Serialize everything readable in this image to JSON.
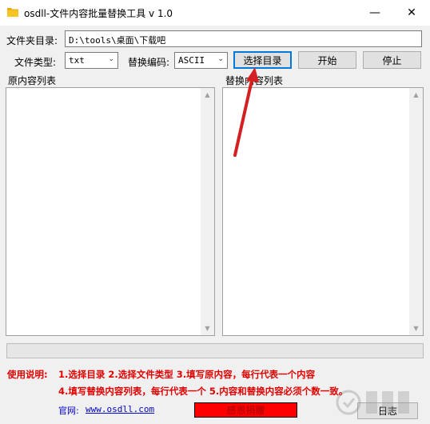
{
  "window": {
    "title": "osdll-文件内容批量替换工具 v 1.0",
    "minimize": "—",
    "close": "✕"
  },
  "folder": {
    "label": "文件夹目录:",
    "value": "D:\\tools\\桌面\\下载吧"
  },
  "file_type": {
    "label": "文件类型:",
    "value": "txt"
  },
  "encoding": {
    "label": "替换编码:",
    "value": "ASCII"
  },
  "buttons": {
    "select_dir": "选择目录",
    "start": "开始",
    "stop": "停止",
    "donate": "感恩捐赠",
    "log": "日志"
  },
  "lists": {
    "original": "原内容列表",
    "replacement": "替换内容列表"
  },
  "help": {
    "label": "使用说明:",
    "line1": "1.选择目录   2.选择文件类型   3.填写原内容，每行代表一个内容",
    "line2": "4.填写替换内容列表，每行代表一个   5.内容和替换内容必须个数一致。"
  },
  "footer": {
    "site_label": "官网:",
    "site_url": "www.osdll.com"
  },
  "colors": {
    "help_text": "#e00000",
    "donate_bg": "#ff0000",
    "annotation_arrow": "#d42020",
    "focus_border": "#0078d7"
  }
}
